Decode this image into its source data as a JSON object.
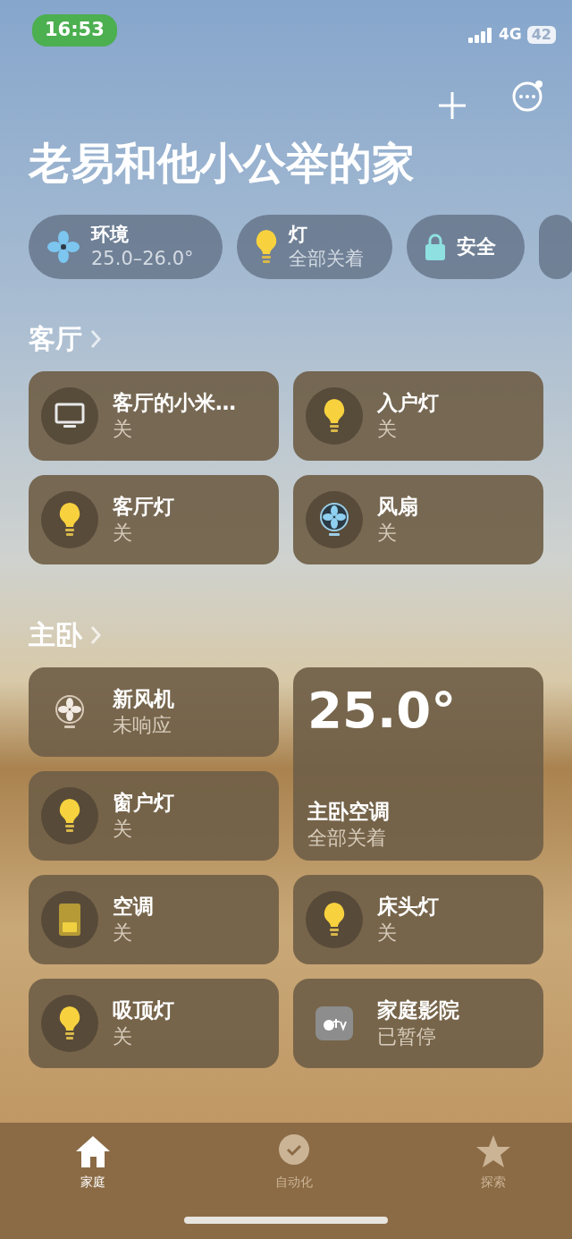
{
  "status_bar": {
    "time": "16:53",
    "network": "4G",
    "battery": "42"
  },
  "home": {
    "title": "老易和他小公举的家"
  },
  "summary_chips": [
    {
      "kind": "climate",
      "title": "环境",
      "subtitle": "25.0–26.0°"
    },
    {
      "kind": "lights",
      "title": "灯",
      "subtitle": "全部关着"
    },
    {
      "kind": "security",
      "title": "安全"
    },
    {
      "kind": "partial"
    }
  ],
  "rooms": [
    {
      "name": "客厅",
      "accessories": [
        {
          "kind": "tv",
          "name": "客厅的小米…",
          "status": "关"
        },
        {
          "kind": "light",
          "name": "入户灯",
          "status": "关"
        },
        {
          "kind": "light",
          "name": "客厅灯",
          "status": "关"
        },
        {
          "kind": "fan",
          "name": "风扇",
          "status": "关"
        }
      ]
    },
    {
      "name": "主卧",
      "accessories": [
        {
          "kind": "purifier",
          "name": "新风机",
          "status": "未响应"
        },
        {
          "kind": "light",
          "name": "窗户灯",
          "status": "关"
        },
        {
          "kind": "thermostat",
          "name": "主卧空调",
          "status": "全部关着",
          "reading": "25.0°"
        },
        {
          "kind": "ac",
          "name": "空调",
          "status": "关"
        },
        {
          "kind": "light",
          "name": "床头灯",
          "status": "关"
        },
        {
          "kind": "light",
          "name": "吸顶灯",
          "status": "关"
        },
        {
          "kind": "appletv",
          "name": "家庭影院",
          "status": "已暂停"
        }
      ]
    }
  ],
  "tab_bar": [
    {
      "kind": "home",
      "label": "家庭",
      "selected": true
    },
    {
      "kind": "automation",
      "label": "自动化",
      "selected": false
    },
    {
      "kind": "discover",
      "label": "探索",
      "selected": false
    }
  ]
}
